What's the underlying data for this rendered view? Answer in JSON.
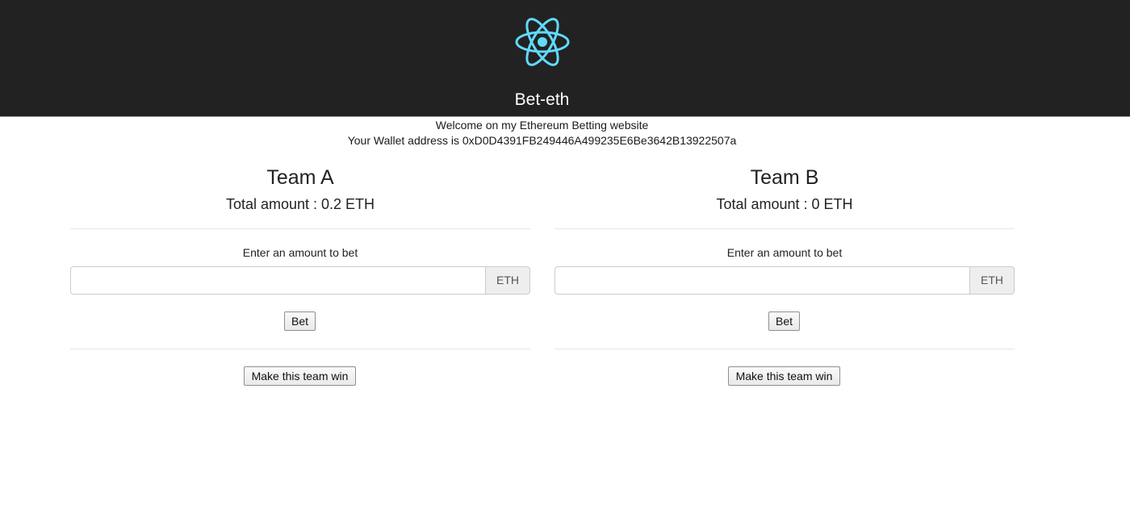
{
  "header": {
    "logo_icon": "react-atom-icon",
    "logo_color": "#61dafb",
    "background": "#222222",
    "title": "Bet-eth"
  },
  "intro": {
    "welcome": "Welcome on my Ethereum Betting website",
    "wallet": "Your Wallet address is 0xD0D4391FB249446A499235E6Be3642B13922507a"
  },
  "teams": [
    {
      "name": "Team A",
      "total": "Total amount : 0.2 ETH",
      "bet_prompt": "Enter an amount to bet",
      "input_value": "",
      "currency": "ETH",
      "bet_label": "Bet",
      "win_label": "Make this team win"
    },
    {
      "name": "Team B",
      "total": "Total amount : 0 ETH",
      "bet_prompt": "Enter an amount to bet",
      "input_value": "",
      "currency": "ETH",
      "bet_label": "Bet",
      "win_label": "Make this team win"
    }
  ]
}
